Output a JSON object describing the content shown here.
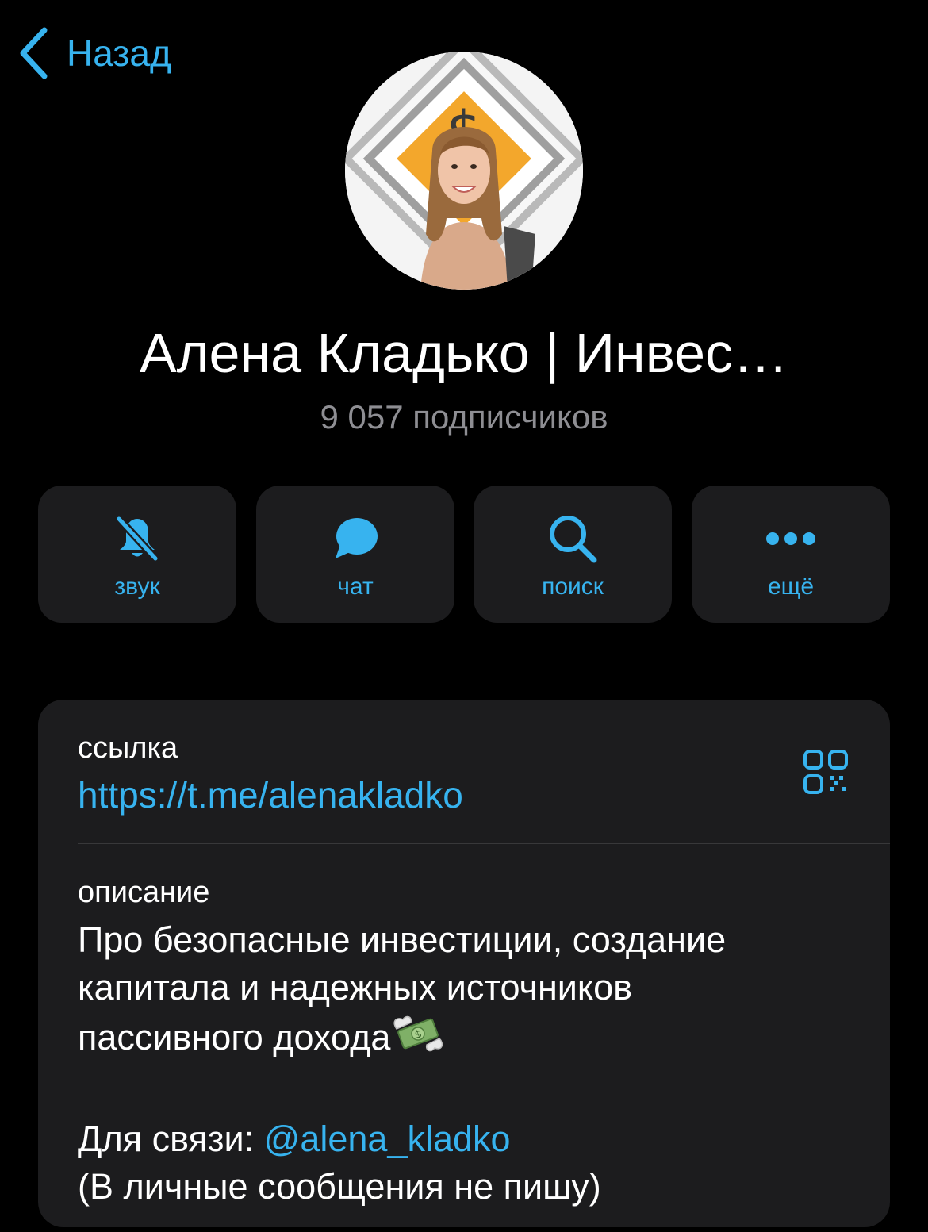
{
  "nav": {
    "back_label": "Назад"
  },
  "channel": {
    "title": "Алена Кладько | Инвес…",
    "subscribers": "9 057 подписчиков"
  },
  "actions": [
    {
      "label": "звук",
      "icon": "bell-slash-icon"
    },
    {
      "label": "чат",
      "icon": "chat-bubble-icon"
    },
    {
      "label": "поиск",
      "icon": "search-icon"
    },
    {
      "label": "ещё",
      "icon": "more-dots-icon"
    }
  ],
  "info": {
    "link_label": "ссылка",
    "link": "https://t.me/alenakladko",
    "description_label": "описание",
    "description_lines": [
      "Про безопасные инвестиции, создание",
      "капитала и надежных источников",
      "пассивного дохода"
    ],
    "description_emoji": "money-with-wings-icon",
    "contact_prefix": "Для связи: ",
    "contact_handle": "@alena_kladko",
    "contact_note": "(В личные сообщения не пишу)"
  },
  "colors": {
    "accent": "#37b3ef",
    "background": "#000000",
    "card": "#1c1c1e",
    "secondary_text": "#8e8e93"
  }
}
